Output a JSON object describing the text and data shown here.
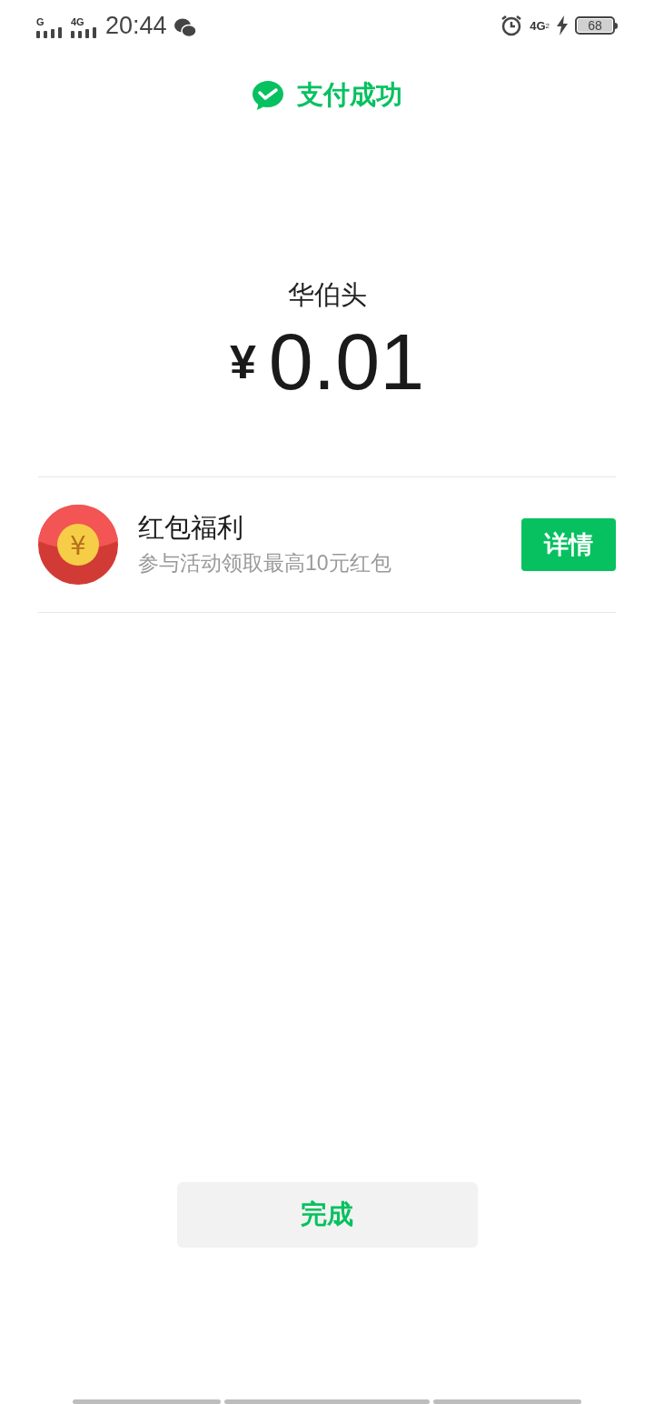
{
  "status_bar": {
    "sim1": "G",
    "sim2": "4G",
    "time": "20:44",
    "network": "4G",
    "network_sub": "2",
    "battery": "68"
  },
  "header": {
    "title": "支付成功"
  },
  "payment": {
    "merchant": "华伯头",
    "currency": "¥",
    "amount": "0.01"
  },
  "promo": {
    "coin_symbol": "¥",
    "title": "红包福利",
    "subtitle": "参与活动领取最高10元红包",
    "button": "详情"
  },
  "done_button": "完成"
}
